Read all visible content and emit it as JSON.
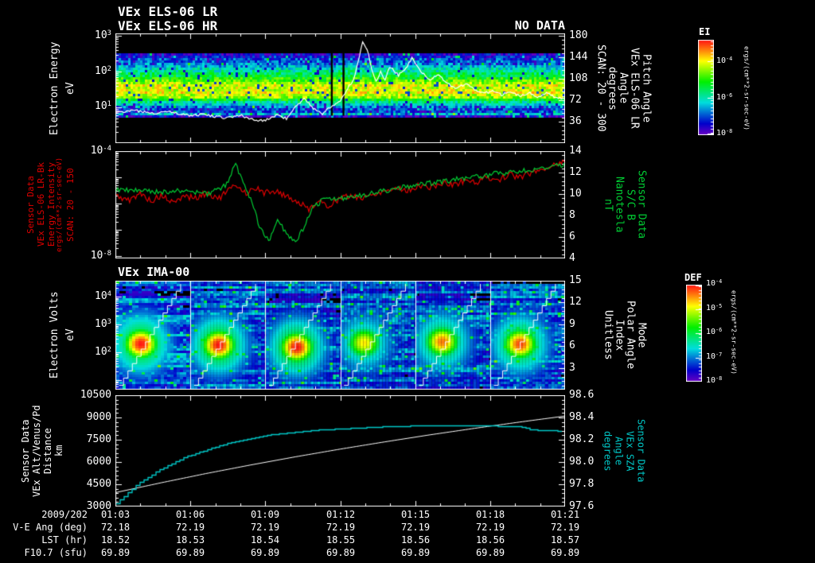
{
  "header": {
    "title1": "VEx ELS-06 LR",
    "title2": "VEx ELS-06 HR",
    "no_data": "NO DATA"
  },
  "panel1": {
    "left_label_lines": [
      "Electron Energy",
      "eV"
    ],
    "yticks": [
      {
        "b": "10",
        "e": "3"
      },
      {
        "b": "10",
        "e": "2"
      },
      {
        "b": "10",
        "e": "1"
      }
    ],
    "right_ticks": [
      "180",
      "144",
      "108",
      "72",
      "36"
    ],
    "right_label_lines": [
      "Pitch Angle",
      "VEx ELS-06 LR",
      "Angle",
      "degrees",
      "SCAN: 20 - 300"
    ]
  },
  "panel2": {
    "left_label_lines": [
      "Sensor Data",
      "VEx ELS-06 LR-Bk",
      "Energy Intensity",
      "ergs/(cm**2-sr-sec-eV)",
      "SCAN: 20 - 150"
    ],
    "yticks": [
      {
        "b": "10",
        "e": "-4"
      },
      {
        "b": "10",
        "e": "-8"
      }
    ],
    "right_ticks": [
      "14",
      "12",
      "10",
      "8",
      "6",
      "4"
    ],
    "right_label_lines": [
      "Sensor Data",
      "S/C B",
      "Nanotesla",
      "nT"
    ]
  },
  "panel3": {
    "title": "VEx IMA-00",
    "left_label_lines": [
      "Electron Volts",
      "eV"
    ],
    "yticks": [
      {
        "b": "10",
        "e": "4"
      },
      {
        "b": "10",
        "e": "3"
      },
      {
        "b": "10",
        "e": "2"
      }
    ],
    "right_ticks": [
      "15",
      "12",
      "9",
      "6",
      "3"
    ],
    "right_label_lines": [
      "Mode",
      "Polar Angle",
      "Index",
      "Unitless"
    ]
  },
  "panel4": {
    "left_label_lines": [
      "Sensor Data",
      "VEx Alt/Venus/Pd",
      "Distance",
      "km"
    ],
    "yticks": [
      "10500",
      "9000",
      "7500",
      "6000",
      "4500",
      "3000"
    ],
    "right_ticks": [
      "98.6",
      "98.4",
      "98.2",
      "98.0",
      "97.8",
      "97.6"
    ],
    "right_label_lines": [
      "Sensor Data",
      "VEx SZA",
      "Angle",
      "degrees"
    ]
  },
  "bottom": {
    "date": "2009/202",
    "row_labels": [
      "V-E Ang (deg)",
      "LST (hr)",
      "F10.7 (sfu)"
    ],
    "times": [
      "01:03",
      "01:06",
      "01:09",
      "01:12",
      "01:15",
      "01:18",
      "01:21"
    ],
    "ve_ang": [
      "72.18",
      "72.19",
      "72.19",
      "72.19",
      "72.19",
      "72.19",
      "72.19"
    ],
    "lst": [
      "18.52",
      "18.53",
      "18.54",
      "18.55",
      "18.56",
      "18.56",
      "18.57"
    ],
    "f107": [
      "69.89",
      "69.89",
      "69.89",
      "69.89",
      "69.89",
      "69.89",
      "69.89"
    ]
  },
  "colorbars": {
    "ei": {
      "title": "EI",
      "ticks": [
        {
          "b": "10",
          "e": "-4"
        },
        {
          "b": "10",
          "e": "-6"
        },
        {
          "b": "10",
          "e": "-8"
        }
      ],
      "units": "ergs/(cm**2-sr-sec-eV)"
    },
    "def": {
      "title": "DEF",
      "ticks": [
        {
          "b": "10",
          "e": "-4"
        },
        {
          "b": "10",
          "e": "-5"
        },
        {
          "b": "10",
          "e": "-6"
        },
        {
          "b": "10",
          "e": "-7"
        },
        {
          "b": "10",
          "e": "-8"
        }
      ],
      "units": "ergs/(cm**2-sr-sec-eV)"
    }
  },
  "colors": {
    "background": "#000000",
    "foreground": "#ffffff",
    "red_series": "#e00000",
    "green_series": "#00cc33",
    "cyan_series": "#00c8c8"
  },
  "chart_data": [
    {
      "id": "els",
      "type": "heatmap",
      "title": "VEx ELS-06 LR/HR electron spectrogram",
      "xrange": [
        "01:03",
        "01:21"
      ],
      "ylabel": "Electron Energy (eV)",
      "yscale": "log",
      "yrange": [
        1,
        1200
      ],
      "y2label": "Pitch Angle (degrees) SCAN: 20 - 300",
      "y2range": [
        0,
        180
      ],
      "y2ticks": [
        36,
        72,
        108,
        144,
        180
      ],
      "band_profile": [
        [
          0,
          0
        ],
        [
          0.17,
          0
        ],
        [
          0.185,
          0.14
        ],
        [
          0.23,
          0.2
        ],
        [
          0.3,
          0.32
        ],
        [
          0.36,
          0.48
        ],
        [
          0.42,
          0.65
        ],
        [
          0.47,
          0.75
        ],
        [
          0.53,
          0.78
        ],
        [
          0.57,
          0.7
        ],
        [
          0.6,
          0.52
        ],
        [
          0.63,
          0.35
        ],
        [
          0.67,
          0.22
        ],
        [
          0.7,
          0.18
        ],
        [
          0.72,
          0.32
        ],
        [
          0.735,
          0.25
        ],
        [
          0.75,
          0
        ],
        [
          1,
          0
        ]
      ],
      "gap_xfrac": [
        0.479,
        0.505
      ],
      "trace_frac": [
        [
          0,
          0.72
        ],
        [
          0.04,
          0.7
        ],
        [
          0.08,
          0.73
        ],
        [
          0.12,
          0.71
        ],
        [
          0.16,
          0.75
        ],
        [
          0.2,
          0.74
        ],
        [
          0.24,
          0.77
        ],
        [
          0.28,
          0.75
        ],
        [
          0.3,
          0.78
        ],
        [
          0.33,
          0.8
        ],
        [
          0.36,
          0.74
        ],
        [
          0.38,
          0.78
        ],
        [
          0.4,
          0.66
        ],
        [
          0.42,
          0.6
        ],
        [
          0.44,
          0.68
        ],
        [
          0.46,
          0.74
        ],
        [
          0.48,
          0.66
        ],
        [
          0.5,
          0.62
        ],
        [
          0.51,
          0.55
        ],
        [
          0.52,
          0.48
        ],
        [
          0.53,
          0.42
        ],
        [
          0.54,
          0.25
        ],
        [
          0.55,
          0.08
        ],
        [
          0.56,
          0.14
        ],
        [
          0.57,
          0.32
        ],
        [
          0.58,
          0.44
        ],
        [
          0.59,
          0.35
        ],
        [
          0.6,
          0.42
        ],
        [
          0.61,
          0.3
        ],
        [
          0.63,
          0.38
        ],
        [
          0.65,
          0.3
        ],
        [
          0.66,
          0.22
        ],
        [
          0.67,
          0.28
        ],
        [
          0.68,
          0.35
        ],
        [
          0.7,
          0.42
        ],
        [
          0.72,
          0.38
        ],
        [
          0.74,
          0.46
        ],
        [
          0.76,
          0.5
        ],
        [
          0.78,
          0.46
        ],
        [
          0.8,
          0.52
        ],
        [
          0.82,
          0.55
        ],
        [
          0.84,
          0.52
        ],
        [
          0.86,
          0.56
        ],
        [
          0.88,
          0.53
        ],
        [
          0.9,
          0.57
        ],
        [
          0.92,
          0.54
        ],
        [
          0.94,
          0.58
        ],
        [
          0.96,
          0.55
        ],
        [
          0.98,
          0.58
        ],
        [
          1,
          0.6
        ]
      ]
    },
    {
      "id": "intensity_b",
      "type": "line",
      "series": [
        {
          "name": "VEx ELS-06 LR-Bk Energy Intensity SCAN: 20 - 150",
          "units": "ergs/(cm**2-sr-sec-eV)",
          "color": "#e00000",
          "axis": "left_log10",
          "range": [
            -8,
            -4
          ],
          "noise": 0.12,
          "points": [
            [
              0,
              -5.7
            ],
            [
              0.03,
              -5.9
            ],
            [
              0.05,
              -5.6
            ],
            [
              0.08,
              -5.9
            ],
            [
              0.1,
              -5.7
            ],
            [
              0.13,
              -6.0
            ],
            [
              0.15,
              -5.7
            ],
            [
              0.18,
              -5.8
            ],
            [
              0.2,
              -5.6
            ],
            [
              0.23,
              -5.8
            ],
            [
              0.25,
              -5.5
            ],
            [
              0.27,
              -5.3
            ],
            [
              0.29,
              -5.6
            ],
            [
              0.31,
              -5.4
            ],
            [
              0.33,
              -5.6
            ],
            [
              0.35,
              -5.5
            ],
            [
              0.38,
              -5.7
            ],
            [
              0.4,
              -5.9
            ],
            [
              0.43,
              -6.2
            ],
            [
              0.45,
              -5.9
            ],
            [
              0.47,
              -6.1
            ],
            [
              0.5,
              -5.8
            ],
            [
              0.53,
              -5.7
            ],
            [
              0.55,
              -5.8
            ],
            [
              0.58,
              -5.6
            ],
            [
              0.6,
              -5.5
            ],
            [
              0.63,
              -5.4
            ],
            [
              0.65,
              -5.5
            ],
            [
              0.68,
              -5.3
            ],
            [
              0.7,
              -5.4
            ],
            [
              0.73,
              -5.2
            ],
            [
              0.75,
              -5.3
            ],
            [
              0.78,
              -5.1
            ],
            [
              0.8,
              -5.2
            ],
            [
              0.83,
              -5.0
            ],
            [
              0.85,
              -5.1
            ],
            [
              0.88,
              -4.9
            ],
            [
              0.9,
              -5.0
            ],
            [
              0.93,
              -4.8
            ],
            [
              0.95,
              -4.7
            ],
            [
              0.98,
              -4.5
            ],
            [
              1,
              -4.4
            ]
          ]
        },
        {
          "name": "S/C B",
          "units": "nT",
          "color": "#00cc33",
          "axis": "right",
          "range": [
            4,
            14
          ],
          "noise": 0.25,
          "points": [
            [
              0,
              10.4
            ],
            [
              0.05,
              10.3
            ],
            [
              0.1,
              10.2
            ],
            [
              0.15,
              10.3
            ],
            [
              0.2,
              10.0
            ],
            [
              0.23,
              10.4
            ],
            [
              0.25,
              11.0
            ],
            [
              0.265,
              12.9
            ],
            [
              0.28,
              11.5
            ],
            [
              0.3,
              9.5
            ],
            [
              0.32,
              7.0
            ],
            [
              0.34,
              5.6
            ],
            [
              0.36,
              7.8
            ],
            [
              0.38,
              6.2
            ],
            [
              0.4,
              5.4
            ],
            [
              0.42,
              7.0
            ],
            [
              0.44,
              8.8
            ],
            [
              0.46,
              9.4
            ],
            [
              0.5,
              9.6
            ],
            [
              0.55,
              9.9
            ],
            [
              0.6,
              10.3
            ],
            [
              0.65,
              10.7
            ],
            [
              0.7,
              11.0
            ],
            [
              0.75,
              11.3
            ],
            [
              0.8,
              11.6
            ],
            [
              0.85,
              11.9
            ],
            [
              0.9,
              12.1
            ],
            [
              0.95,
              12.4
            ],
            [
              1,
              12.7
            ]
          ]
        }
      ]
    },
    {
      "id": "ima",
      "type": "heatmap",
      "title": "VEx IMA-00 ion spectrogram",
      "ylabel": "Electron Volts (eV)",
      "yscale": "log",
      "yrange": [
        5,
        30000
      ],
      "y2label": "Mode / Polar Angle Index (Unitless)",
      "y2range": [
        0,
        15
      ],
      "y2ticks": [
        3,
        6,
        9,
        12,
        15
      ],
      "blob_rx": 0.24,
      "blob_ry": 0.15,
      "subpanels": [
        {
          "cx": 0.32,
          "cy": 0.57,
          "i": 1.0
        },
        {
          "cx": 0.36,
          "cy": 0.58,
          "i": 1.0
        },
        {
          "cx": 0.4,
          "cy": 0.6,
          "i": 1.0
        },
        {
          "cx": 0.3,
          "cy": 0.56,
          "i": 0.8
        },
        {
          "cx": 0.34,
          "cy": 0.55,
          "i": 0.9
        },
        {
          "cx": 0.38,
          "cy": 0.57,
          "i": 0.95
        }
      ]
    },
    {
      "id": "alt_sza",
      "type": "line",
      "series": [
        {
          "name": "VEx Alt/Venus/Pd Distance",
          "units": "km",
          "color": "#ffffff",
          "axis": "left",
          "range": [
            3000,
            10500
          ],
          "points": [
            [
              0,
              3950
            ],
            [
              0.1,
              4600
            ],
            [
              0.2,
              5220
            ],
            [
              0.3,
              5800
            ],
            [
              0.4,
              6350
            ],
            [
              0.5,
              6870
            ],
            [
              0.6,
              7360
            ],
            [
              0.7,
              7830
            ],
            [
              0.8,
              8270
            ],
            [
              0.9,
              8690
            ],
            [
              1,
              9090
            ]
          ]
        },
        {
          "name": "VEx SZA",
          "units": "degrees",
          "color": "#00c8c8",
          "axis": "right",
          "range": [
            97.6,
            98.6
          ],
          "points": [
            [
              0,
              97.63
            ],
            [
              0.05,
              97.81
            ],
            [
              0.1,
              97.94
            ],
            [
              0.15,
              98.04
            ],
            [
              0.2,
              98.11
            ],
            [
              0.25,
              98.17
            ],
            [
              0.3,
              98.21
            ],
            [
              0.35,
              98.25
            ],
            [
              0.4,
              98.27
            ],
            [
              0.45,
              98.29
            ],
            [
              0.5,
              98.3
            ],
            [
              0.55,
              98.31
            ],
            [
              0.6,
              98.32
            ],
            [
              0.7,
              98.33
            ],
            [
              0.8,
              98.33
            ],
            [
              0.9,
              98.32
            ],
            [
              0.93,
              98.29
            ],
            [
              1,
              98.28
            ]
          ]
        }
      ]
    }
  ]
}
